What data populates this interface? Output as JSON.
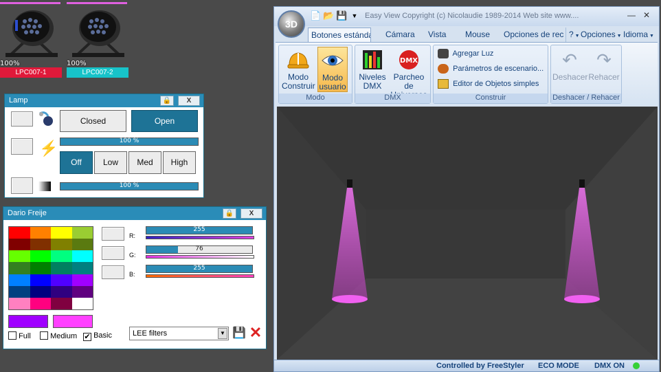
{
  "fixtures": [
    {
      "name": "LPC007-1",
      "percent": "100%",
      "label_color": "#e0193a"
    },
    {
      "name": "LPC007-2",
      "percent": "100%",
      "label_color": "#17c3c9"
    }
  ],
  "lamp_panel": {
    "title": "Lamp",
    "lock_icon": "lock-icon",
    "close_label": "X",
    "shutter": {
      "closed_label": "Closed",
      "open_label": "Open"
    },
    "dimmer_bar_text": "100  %",
    "dimmer_value": 1.0,
    "strobe": {
      "off_label": "Off",
      "low_label": "Low",
      "med_label": "Med",
      "high_label": "High"
    },
    "fader_bar_text": "100  %",
    "fader_value": 1.0
  },
  "color_panel": {
    "title": "Dario Freije",
    "lock_icon": "lock-icon",
    "close_label": "X",
    "palette": [
      [
        "#ff0000",
        "#ff8000",
        "#ffff00",
        "#9acd32"
      ],
      [
        "#800000",
        "#803000",
        "#808000",
        "#5a7a10"
      ],
      [
        "#66ff00",
        "#00ff00",
        "#00ff80",
        "#00ffff"
      ],
      [
        "#338020",
        "#008000",
        "#008060",
        "#008080"
      ],
      [
        "#0080ff",
        "#0000ff",
        "#5000ff",
        "#a000ff"
      ],
      [
        "#004080",
        "#000080",
        "#300080",
        "#600080"
      ],
      [
        "#ff80c0",
        "#ff0080",
        "#800040",
        "#ffffff"
      ]
    ],
    "swatch_left": "#a000ff",
    "swatch_right": "#ff40ff",
    "r_label": "R:",
    "g_label": "G:",
    "b_label": "B:",
    "r_value": "255",
    "g_value": "76",
    "b_value": "255",
    "r_fraction": 1.0,
    "g_fraction": 0.298,
    "b_fraction": 1.0,
    "options": {
      "full": "Full",
      "medium": "Medium",
      "basic": "Basic"
    },
    "full_checked": false,
    "medium_checked": false,
    "basic_checked": true,
    "filter_select": "LEE filters"
  },
  "main_window": {
    "title": "Easy View   Copyright (c) Nicolaudie 1989-2014   Web site www....",
    "orb_label": "3D",
    "tabs": [
      "Botones estánda",
      "Cámara",
      "Vista",
      "Mouse",
      "Opciones de recu"
    ],
    "help_label": "?",
    "opciones_label": "Opciones",
    "idioma_label": "Idioma",
    "modo_group": {
      "label": "Modo",
      "construir": "Modo\nConstruir",
      "usuario": "Modo\nusuario"
    },
    "dmx_group": {
      "label": "DMX",
      "niveles": "Niveles\nDMX",
      "parcheo": "Parcheo de\nUniversos"
    },
    "construir_group": {
      "label": "Construir",
      "agregar": "Agregar Luz",
      "parametros": "Parámetros de escenario...",
      "editor": "Editor de Objetos simples"
    },
    "undo_group": {
      "label": "Deshacer / Rehacer",
      "deshacer": "Deshacer",
      "rehacer": "Rehacer"
    },
    "status": {
      "controlled": "Controlled by FreeStyler",
      "eco": "ECO MODE",
      "dmx": "DMX ON"
    }
  }
}
